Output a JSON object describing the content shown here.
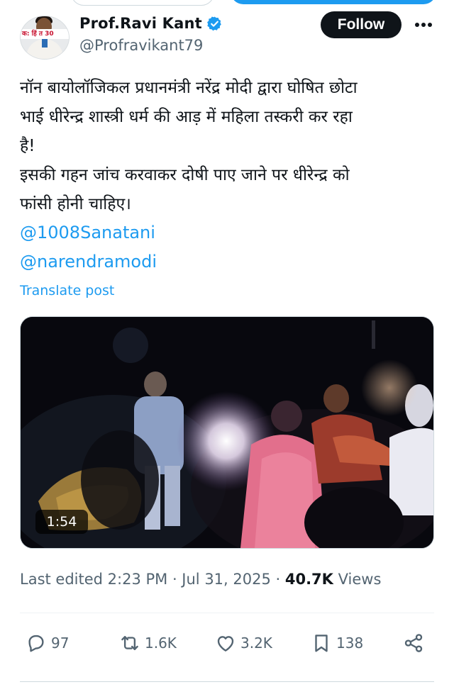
{
  "author": {
    "name": "Prof.Ravi Kant",
    "handle": "@Profravikant79",
    "verified": true,
    "avatar_banner_text": "क: हिं          त 30"
  },
  "follow_label": "Follow",
  "post": {
    "lines": [
      "नॉन बायोलॉजिकल प्रधानमंत्री नरेंद्र मोदी द्वारा घोषित छोटा",
      "भाई धीरेन्द्र शास्त्री धर्म की आड़ में महिला तस्करी कर रहा",
      "है!",
      "इसकी गहन जांच करवाकर दोषी पाए जाने पर धीरेन्द्र को",
      "फांसी होनी चाहिए।"
    ],
    "mentions": [
      "@1008Sanatani",
      "@narendramodi"
    ],
    "translate_label": "Translate post"
  },
  "video": {
    "duration": "1:54"
  },
  "meta": {
    "edited_label": "Last edited 2:23 PM · Jul 31, 2025 · ",
    "views_count": "40.7K",
    "views_label": " Views"
  },
  "actions": {
    "replies": "97",
    "reposts": "1.6K",
    "likes": "3.2K",
    "bookmarks": "138"
  },
  "colors": {
    "accent": "#1d9bf0",
    "text": "#0f1419",
    "secondary": "#536471"
  }
}
